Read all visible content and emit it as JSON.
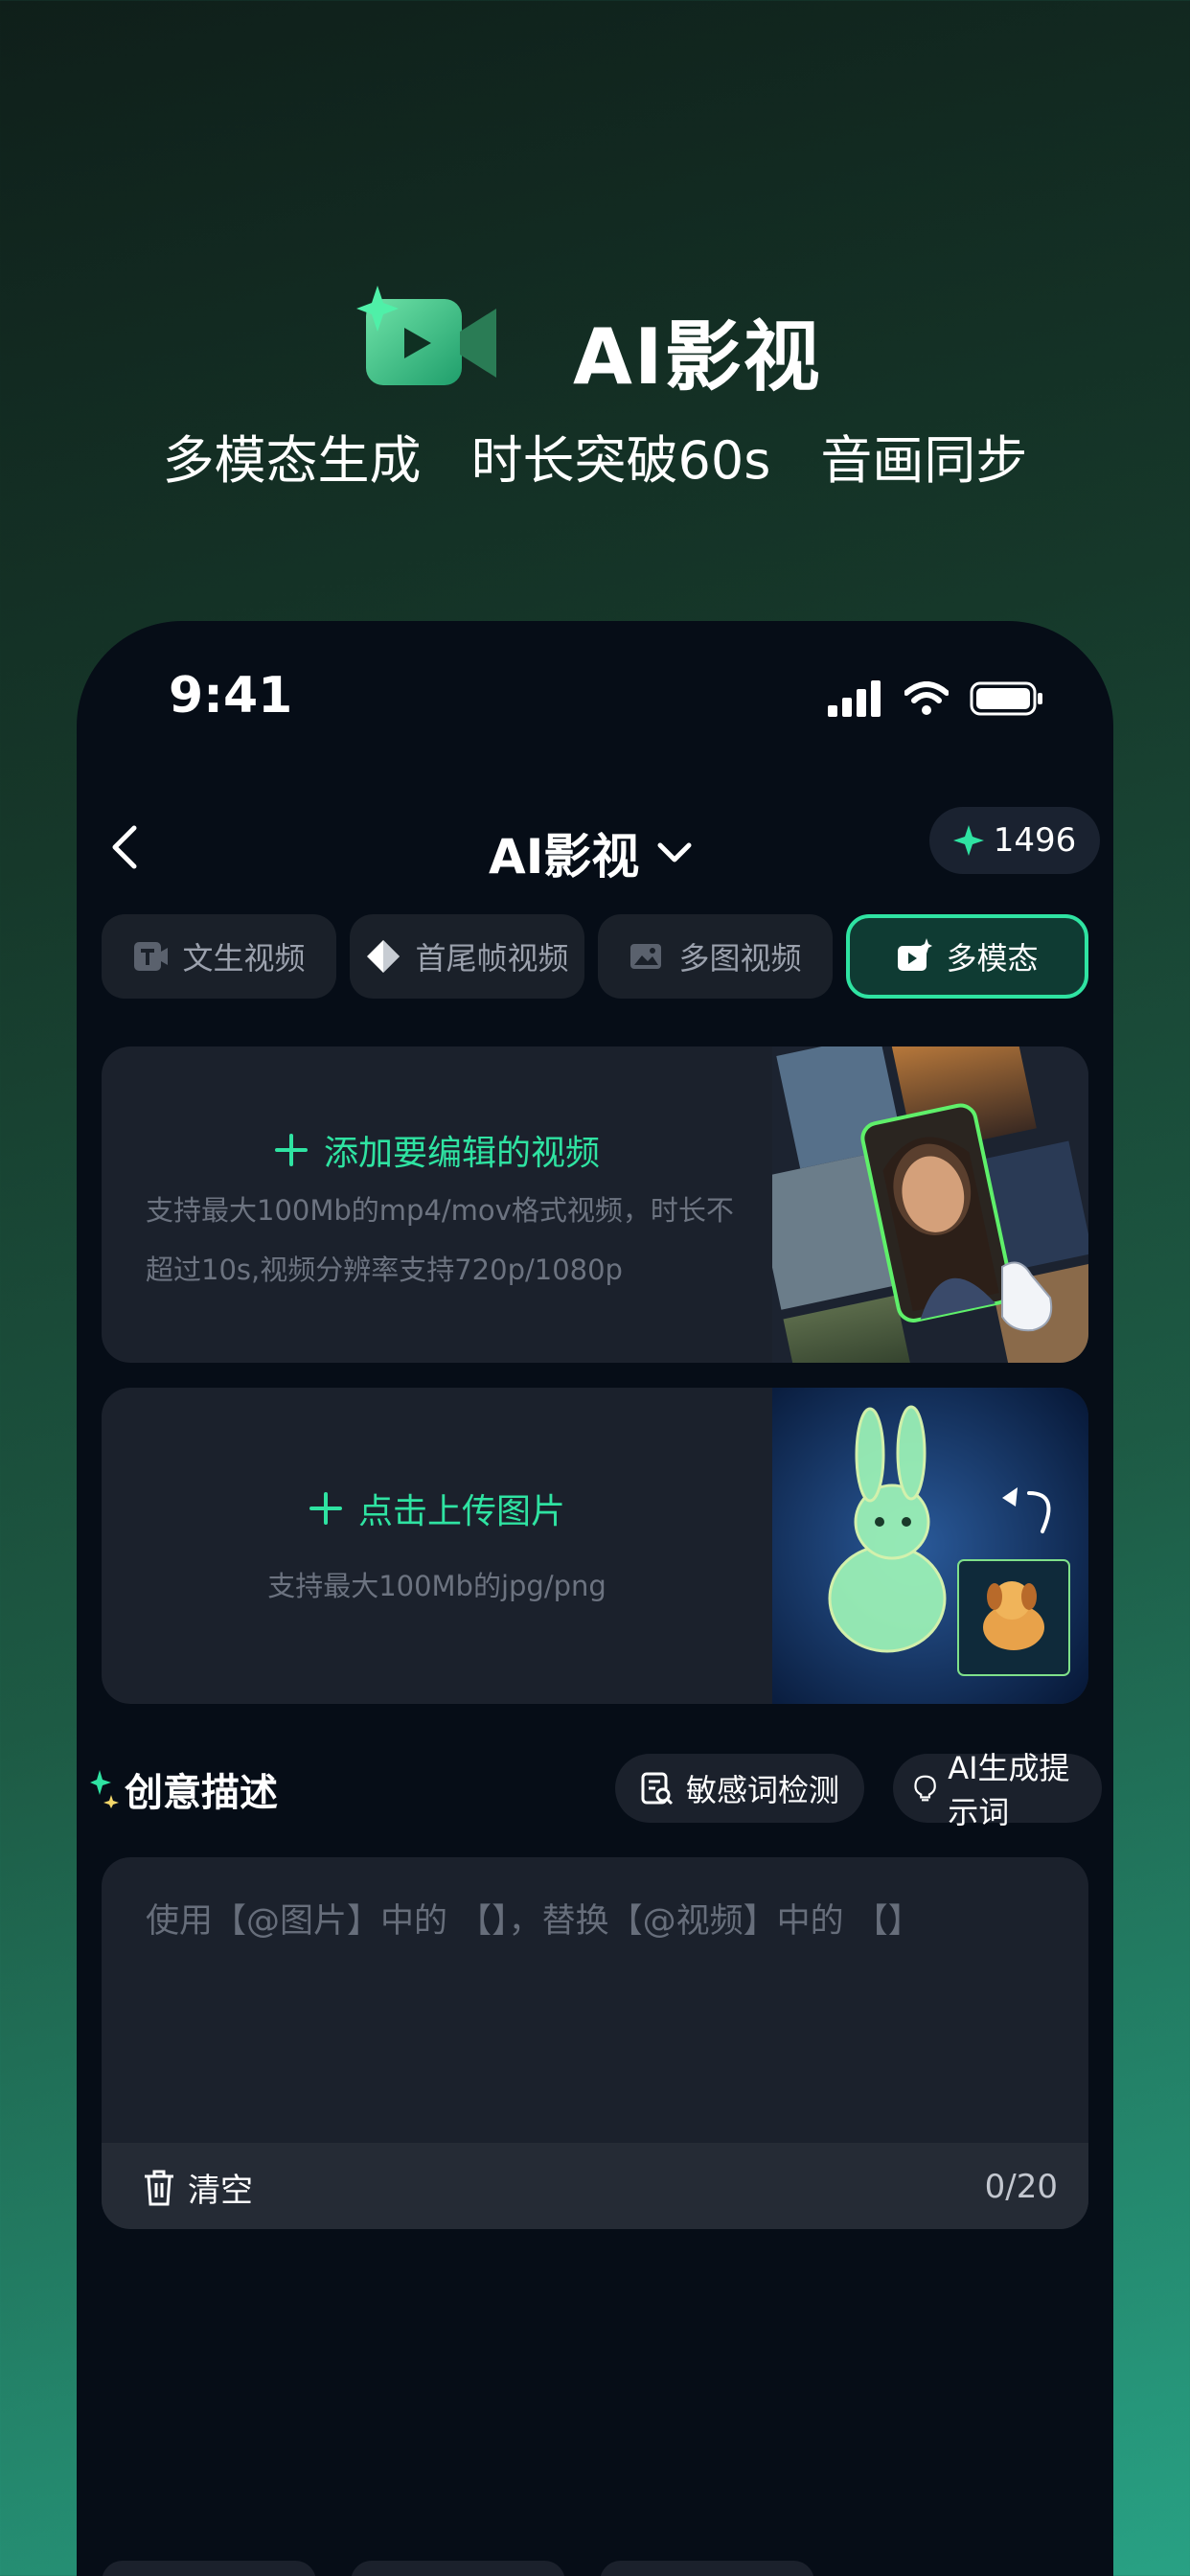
{
  "hero": {
    "title": "AI影视",
    "taglines": [
      "多模态生成",
      "时长突破60s",
      "音画同步"
    ]
  },
  "status_bar": {
    "time": "9:41"
  },
  "nav": {
    "title": "AI影视",
    "credits": "1496"
  },
  "tabs": [
    {
      "label": "文生视频",
      "icon": "text-video-icon",
      "active": false
    },
    {
      "label": "首尾帧视频",
      "icon": "frames-icon",
      "active": false
    },
    {
      "label": "多图视频",
      "icon": "images-icon",
      "active": false
    },
    {
      "label": "多模态",
      "icon": "multimodal-icon",
      "active": true
    }
  ],
  "video_upload": {
    "label": "添加要编辑的视频",
    "hint_line1": "支持最大100Mb的mp4/mov格式视频，时长不",
    "hint_line2": "超过10s,视频分辨率支持720p/1080p"
  },
  "image_upload": {
    "label": "点击上传图片",
    "hint": "支持最大100Mb的jpg/png"
  },
  "creative": {
    "title": "创意描述",
    "sensitive_check": "敏感词检测",
    "ai_prompt": "AI生成提示词",
    "placeholder": "使用【@图片】中的 【】，替换【@视频】中的 【】",
    "clear_label": "清空",
    "count": "0/20"
  },
  "colors": {
    "accent": "#2fe3a2",
    "panel": "#1b212c",
    "phone_bg": "#060d17"
  }
}
